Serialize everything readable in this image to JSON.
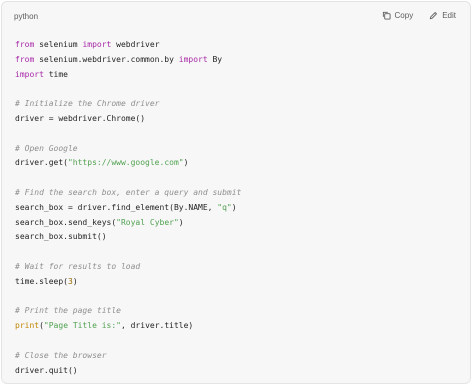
{
  "code_block": {
    "language": "python",
    "copy_label": "Copy",
    "edit_label": "Edit",
    "icons": {
      "copy": "copy-icon",
      "edit": "pencil-icon"
    },
    "lines": [
      {
        "tokens": [
          {
            "t": "kw",
            "v": "from"
          },
          {
            "t": "plain",
            "v": " selenium "
          },
          {
            "t": "kw",
            "v": "import"
          },
          {
            "t": "plain",
            "v": " webdriver"
          }
        ]
      },
      {
        "tokens": [
          {
            "t": "kw",
            "v": "from"
          },
          {
            "t": "plain",
            "v": " selenium.webdriver.common.by "
          },
          {
            "t": "kw",
            "v": "import"
          },
          {
            "t": "plain",
            "v": " By"
          }
        ]
      },
      {
        "tokens": [
          {
            "t": "kw",
            "v": "import"
          },
          {
            "t": "plain",
            "v": " time"
          }
        ]
      },
      {
        "tokens": []
      },
      {
        "tokens": [
          {
            "t": "cm",
            "v": "# Initialize the Chrome driver"
          }
        ]
      },
      {
        "tokens": [
          {
            "t": "plain",
            "v": "driver = webdriver.Chrome()"
          }
        ]
      },
      {
        "tokens": []
      },
      {
        "tokens": [
          {
            "t": "cm",
            "v": "# Open Google"
          }
        ]
      },
      {
        "tokens": [
          {
            "t": "plain",
            "v": "driver.get("
          },
          {
            "t": "str",
            "v": "\"https://www.google.com\""
          },
          {
            "t": "plain",
            "v": ")"
          }
        ]
      },
      {
        "tokens": []
      },
      {
        "tokens": [
          {
            "t": "cm",
            "v": "# Find the search box, enter a query and submit"
          }
        ]
      },
      {
        "tokens": [
          {
            "t": "plain",
            "v": "search_box = driver.find_element(By.NAME, "
          },
          {
            "t": "str",
            "v": "\"q\""
          },
          {
            "t": "plain",
            "v": ")"
          }
        ]
      },
      {
        "tokens": [
          {
            "t": "plain",
            "v": "search_box.send_keys("
          },
          {
            "t": "str",
            "v": "\"Royal Cyber\""
          },
          {
            "t": "plain",
            "v": ")"
          }
        ]
      },
      {
        "tokens": [
          {
            "t": "plain",
            "v": "search_box.submit()"
          }
        ]
      },
      {
        "tokens": []
      },
      {
        "tokens": [
          {
            "t": "cm",
            "v": "# Wait for results to load"
          }
        ]
      },
      {
        "tokens": [
          {
            "t": "plain",
            "v": "time.sleep("
          },
          {
            "t": "num",
            "v": "3"
          },
          {
            "t": "plain",
            "v": ")"
          }
        ]
      },
      {
        "tokens": []
      },
      {
        "tokens": [
          {
            "t": "cm",
            "v": "# Print the page title"
          }
        ]
      },
      {
        "tokens": [
          {
            "t": "fn",
            "v": "print"
          },
          {
            "t": "plain",
            "v": "("
          },
          {
            "t": "str",
            "v": "\"Page Title is:\""
          },
          {
            "t": "plain",
            "v": ", driver.title)"
          }
        ]
      },
      {
        "tokens": []
      },
      {
        "tokens": [
          {
            "t": "cm",
            "v": "# Close the browser"
          }
        ]
      },
      {
        "tokens": [
          {
            "t": "plain",
            "v": "driver.quit()"
          }
        ]
      }
    ]
  },
  "colors": {
    "background": "#f7f7f8",
    "keyword": "#a626a4",
    "string": "#50a14f",
    "comment": "#8f8f8f",
    "number": "#986801",
    "function": "#c18401",
    "text": "#242424"
  }
}
